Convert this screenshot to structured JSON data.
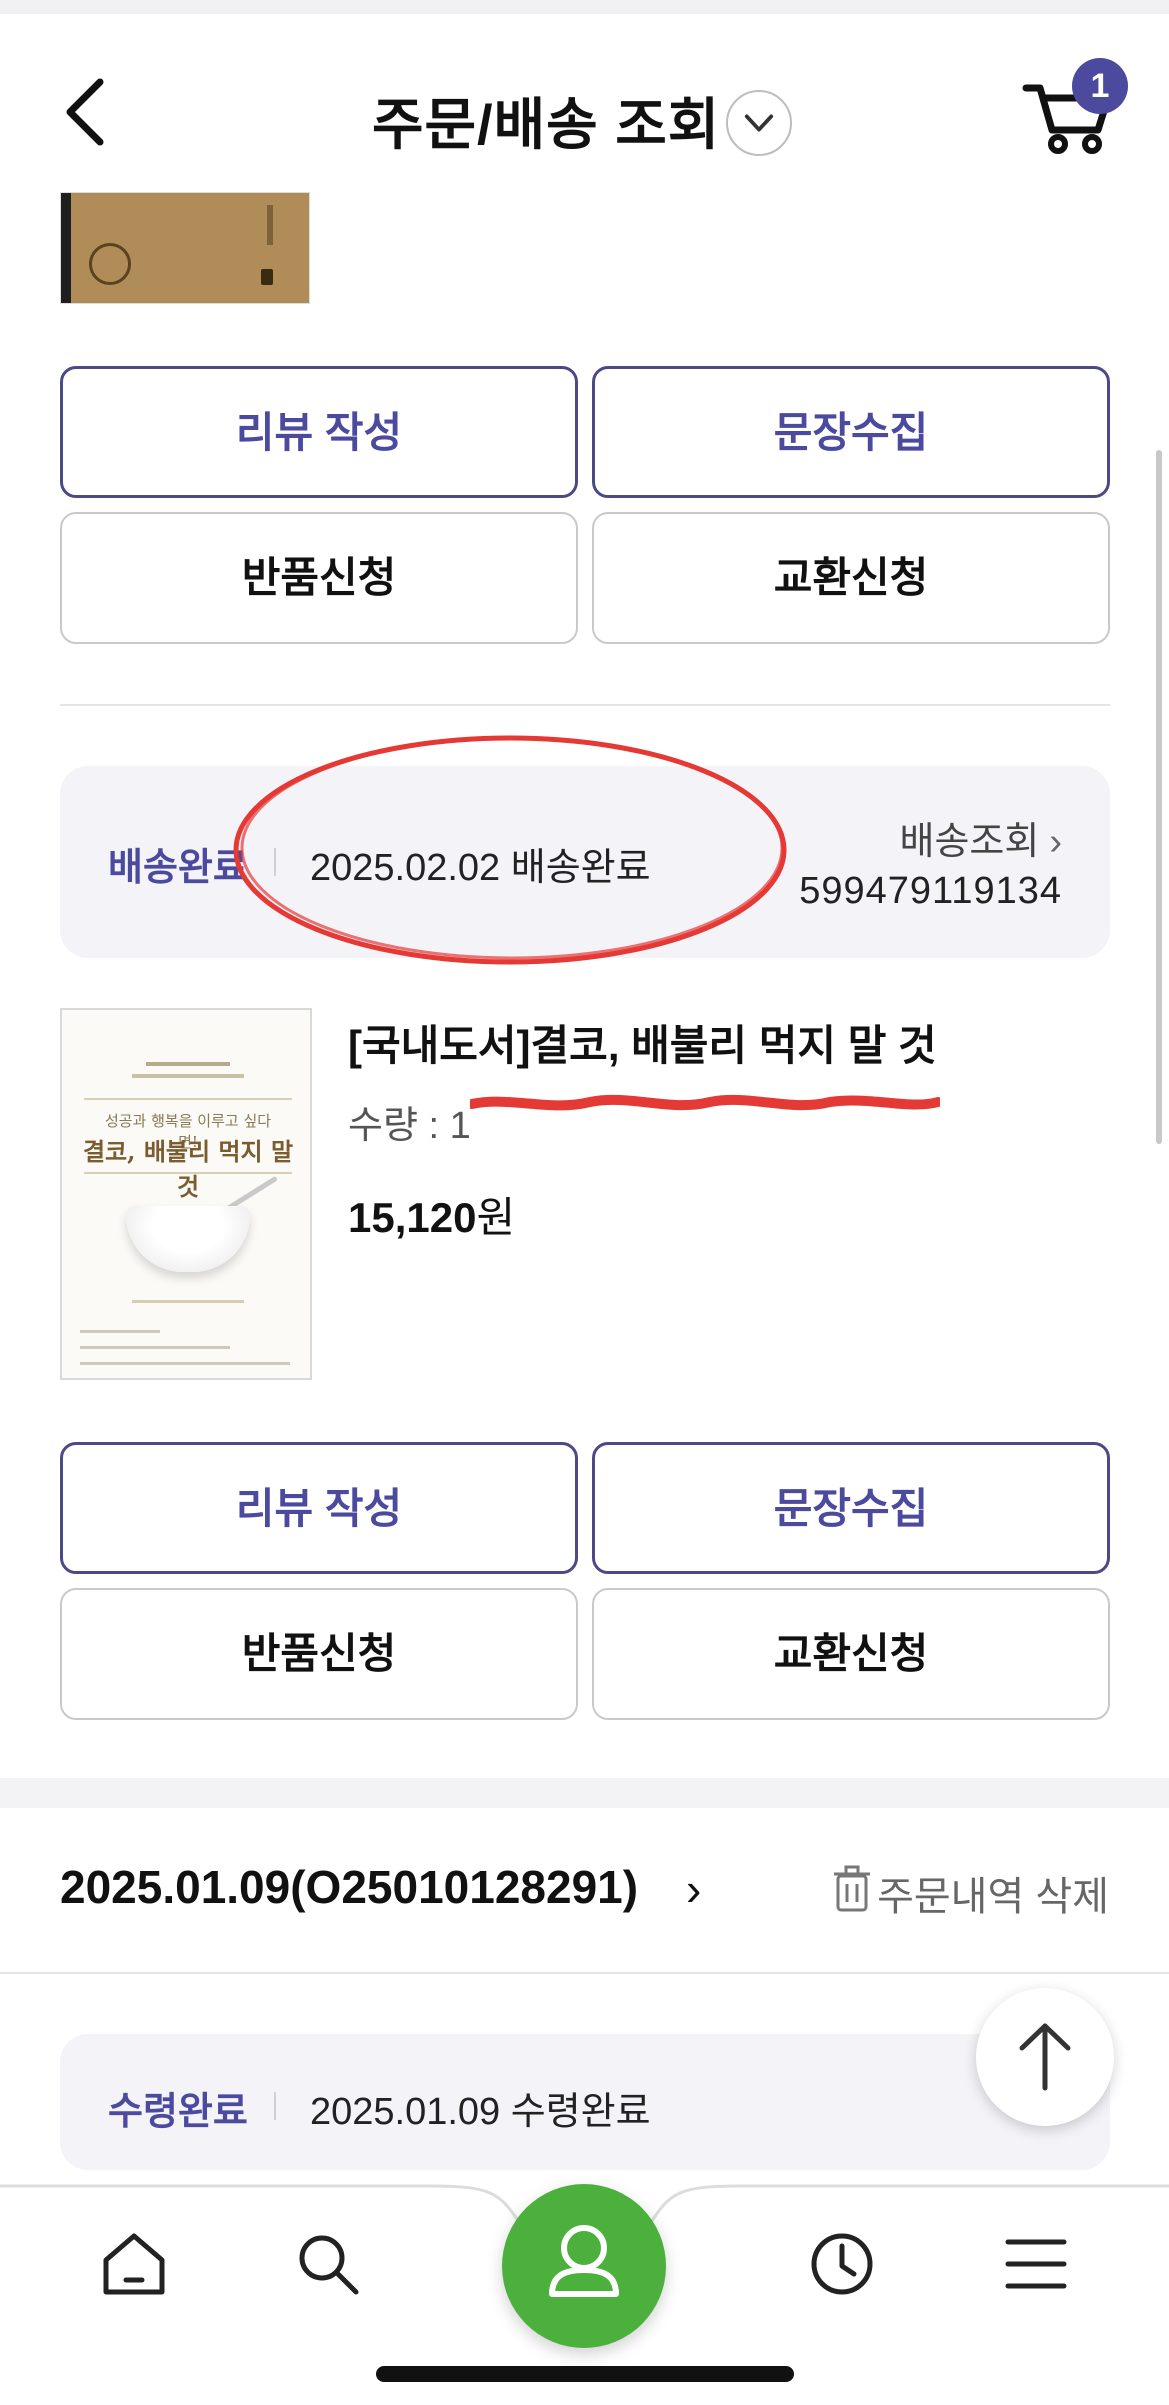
{
  "header": {
    "title": "주문/배송 조회",
    "cart_count": "1"
  },
  "item1": {
    "buttons": {
      "review": "리뷰 작성",
      "collect": "문장수집",
      "return": "반품신청",
      "exchange": "교환신청"
    }
  },
  "shipment": {
    "status_label": "배송완료",
    "status_text": "2025.02.02 배송완료",
    "track_label": "배송조회",
    "tracking_number": "599479119134"
  },
  "product": {
    "title": "[국내도서]결코, 배불리 먹지 말 것",
    "qty_label": "수량 : 1",
    "price": "15,120",
    "currency": "원",
    "cover_tagline": "성공과 행복을 이루고 싶다면!",
    "cover_title": "결코, 배불리 먹지 말 것"
  },
  "item2": {
    "buttons": {
      "review": "리뷰 작성",
      "collect": "문장수집",
      "return": "반품신청",
      "exchange": "교환신청"
    }
  },
  "order": {
    "title": "2025.01.09(O25010128291)",
    "delete_label": "주문내역 삭제",
    "status_label": "수령완료",
    "status_text": "2025.01.09 수령완료"
  },
  "nav": {
    "items": [
      "home-icon",
      "search-icon",
      "user-icon",
      "clock-icon",
      "menu-icon"
    ]
  },
  "colors": {
    "accent": "#4b4a9e",
    "nav_center": "#4bb03c",
    "annotation": "#e53935"
  }
}
